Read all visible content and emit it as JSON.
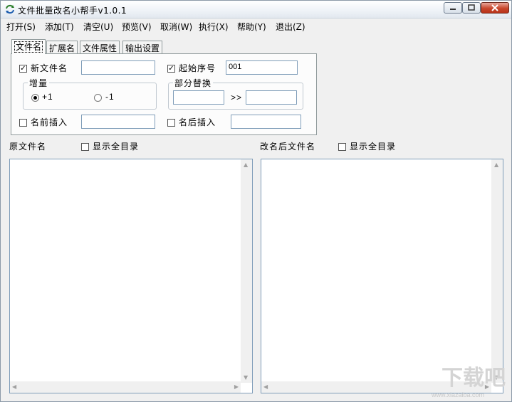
{
  "window": {
    "title": "文件批量改名小帮手v1.0.1"
  },
  "menu": [
    {
      "label": "打开(S)"
    },
    {
      "label": "添加(T)"
    },
    {
      "label": "清空(U)"
    },
    {
      "label": "预览(V)"
    },
    {
      "label": "取消(W)"
    },
    {
      "label": "执行(X)"
    },
    {
      "label": "帮助(Y)"
    },
    {
      "label": "退出(Z)"
    }
  ],
  "tabs": [
    {
      "label": "文件名",
      "active": true
    },
    {
      "label": "扩展名",
      "active": false
    },
    {
      "label": "文件属性",
      "active": false
    },
    {
      "label": "输出设置",
      "active": false
    }
  ],
  "options": {
    "new_name": {
      "label": "新文件名",
      "checked": true,
      "value": ""
    },
    "start_seq": {
      "label": "起始序号",
      "checked": true,
      "value": "001"
    },
    "increment": {
      "title": "增量",
      "plus": "+1",
      "minus": "-1",
      "selected": "+1"
    },
    "replace": {
      "title": "部分替换",
      "arrow": ">>",
      "from": "",
      "to": ""
    },
    "prefix": {
      "label": "名前插入",
      "checked": false,
      "value": ""
    },
    "suffix": {
      "label": "名后插入",
      "checked": false,
      "value": ""
    }
  },
  "lists": {
    "original": {
      "title": "原文件名",
      "show_all_label": "显示全目录",
      "show_all_checked": false
    },
    "renamed": {
      "title": "改名后文件名",
      "show_all_label": "显示全目录",
      "show_all_checked": false
    }
  },
  "watermark": {
    "logo": "下载吧",
    "site": "www.xiazaiba.com"
  },
  "icons": {
    "app": "refresh-arrows-icon",
    "minimize": "minimize-icon",
    "maximize": "maximize-icon",
    "close": "close-icon"
  }
}
